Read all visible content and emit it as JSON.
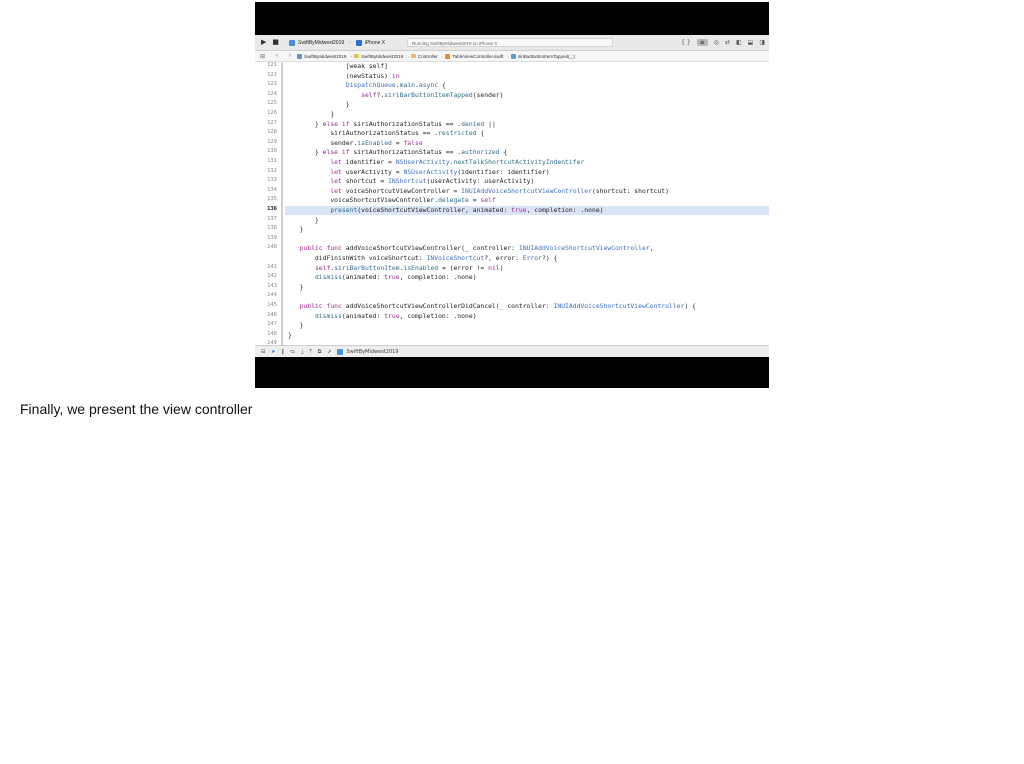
{
  "caption": "Finally, we present the view controller",
  "toolbar": {
    "run_icon": "play-icon",
    "stop_icon": "stop-icon",
    "scheme": "SwiftByMidwest2019",
    "device": "iPhone X",
    "status": "Running SwiftByMidwest2019 on iPhone X",
    "right_icons": [
      "curly-braces-icon",
      "standard-editor-icon",
      "assistant-editor-icon",
      "version-editor-icon",
      "navigator-toggle-icon",
      "debug-area-toggle-icon",
      "inspector-toggle-icon"
    ]
  },
  "jumpbar": {
    "crumbs": [
      "SwiftByMidwest2019",
      "SwiftByMidwest2019",
      "Controller",
      "TableViewController.swift",
      "siriBarButtonItemTapped(_:)"
    ]
  },
  "gutter": [
    "121",
    "122",
    "123",
    "124",
    "125",
    "126",
    "127",
    "128",
    "129",
    "130",
    "131",
    "132",
    "133",
    "134",
    "135",
    "136",
    "137",
    "138",
    "139",
    "140",
    "",
    "141",
    "142",
    "143",
    "144",
    "145",
    "146",
    "147",
    "148",
    "149"
  ],
  "current_line": "136",
  "code_lines": [
    [
      [
        "p",
        "               [weak self]"
      ]
    ],
    [
      [
        "p",
        "               (newStatus) "
      ],
      [
        "k",
        "in"
      ]
    ],
    [
      [
        "p",
        "               "
      ],
      [
        "t",
        "DispatchQueue"
      ],
      [
        "p",
        "."
      ],
      [
        "r",
        "main"
      ],
      [
        "p",
        "."
      ],
      [
        "r",
        "async"
      ],
      [
        "p",
        " {"
      ]
    ],
    [
      [
        "p",
        "                   "
      ],
      [
        "k",
        "self"
      ],
      [
        "p",
        "?."
      ],
      [
        "r",
        "siriBarButtonItemTapped"
      ],
      [
        "p",
        "(sender)"
      ]
    ],
    [
      [
        "p",
        "               }"
      ]
    ],
    [
      [
        "p",
        "           }"
      ]
    ],
    [
      [
        "p",
        "       } "
      ],
      [
        "k",
        "else if"
      ],
      [
        "p",
        " siriAuthorizationStatus == ."
      ],
      [
        "r",
        "denied"
      ],
      [
        "p",
        " ||"
      ]
    ],
    [
      [
        "p",
        "           siriAuthorizationStatus == ."
      ],
      [
        "r",
        "restricted"
      ],
      [
        "p",
        " {"
      ]
    ],
    [
      [
        "p",
        "           sender."
      ],
      [
        "r",
        "isEnabled"
      ],
      [
        "p",
        " = "
      ],
      [
        "k",
        "false"
      ]
    ],
    [
      [
        "p",
        "       } "
      ],
      [
        "k",
        "else if"
      ],
      [
        "p",
        " siriAuthorizationStatus == ."
      ],
      [
        "r",
        "authorized"
      ],
      [
        "p",
        " {"
      ]
    ],
    [
      [
        "p",
        "           "
      ],
      [
        "k",
        "let"
      ],
      [
        "p",
        " identifier = "
      ],
      [
        "t",
        "NSUserActivity"
      ],
      [
        "p",
        "."
      ],
      [
        "r",
        "nextTalkShortcutActivityIndentifer"
      ]
    ],
    [
      [
        "p",
        "           "
      ],
      [
        "k",
        "let"
      ],
      [
        "p",
        " userActivity = "
      ],
      [
        "t",
        "NSUserActivity"
      ],
      [
        "p",
        "(identifier: identifier)"
      ]
    ],
    [
      [
        "p",
        "           "
      ],
      [
        "k",
        "let"
      ],
      [
        "p",
        " shortcut = "
      ],
      [
        "t",
        "INShortcut"
      ],
      [
        "p",
        "(userActivity: userActivity)"
      ]
    ],
    [
      [
        "p",
        "           "
      ],
      [
        "k",
        "let"
      ],
      [
        "p",
        " voiceShortcutViewController = "
      ],
      [
        "t",
        "INUIAddVoiceShortcutViewController"
      ],
      [
        "p",
        "(shortcut: shortcut)"
      ]
    ],
    [
      [
        "p",
        "           voiceShortcutViewController."
      ],
      [
        "r",
        "delegate"
      ],
      [
        "p",
        " = "
      ],
      [
        "k",
        "self"
      ]
    ],
    [
      [
        "p",
        "           "
      ],
      [
        "r",
        "present"
      ],
      [
        "p",
        "(voiceShortcutViewController, animated: "
      ],
      [
        "k",
        "true"
      ],
      [
        "p",
        ", completion: .none)"
      ]
    ],
    [
      [
        "p",
        "       }"
      ]
    ],
    [
      [
        "p",
        "   }"
      ]
    ],
    [
      [
        "p",
        ""
      ]
    ],
    [
      [
        "p",
        "   "
      ],
      [
        "k",
        "public func"
      ],
      [
        "p",
        " addVoiceShortcutViewController(_ controller: "
      ],
      [
        "t",
        "INUIAddVoiceShortcutViewController"
      ],
      [
        "p",
        ","
      ]
    ],
    [
      [
        "p",
        "       didFinishWith voiceShortcut: "
      ],
      [
        "t",
        "INVoiceShortcut"
      ],
      [
        "p",
        "?, error: "
      ],
      [
        "t",
        "Error"
      ],
      [
        "p",
        "?) {"
      ]
    ],
    [
      [
        "p",
        "       "
      ],
      [
        "k",
        "self"
      ],
      [
        "p",
        "."
      ],
      [
        "r",
        "siriBarButtonItem"
      ],
      [
        "p",
        "."
      ],
      [
        "r",
        "isEnabled"
      ],
      [
        "p",
        " = (error != "
      ],
      [
        "k",
        "nil"
      ],
      [
        "p",
        ")"
      ]
    ],
    [
      [
        "p",
        "       "
      ],
      [
        "r",
        "dismiss"
      ],
      [
        "p",
        "(animated: "
      ],
      [
        "k",
        "true"
      ],
      [
        "p",
        ", completion: .none)"
      ]
    ],
    [
      [
        "p",
        "   }"
      ]
    ],
    [
      [
        "p",
        ""
      ]
    ],
    [
      [
        "p",
        "   "
      ],
      [
        "k",
        "public func"
      ],
      [
        "p",
        " addVoiceShortcutViewControllerDidCancel(_ controller: "
      ],
      [
        "t",
        "INUIAddVoiceShortcutViewController"
      ],
      [
        "p",
        ") {"
      ]
    ],
    [
      [
        "p",
        "       "
      ],
      [
        "r",
        "dismiss"
      ],
      [
        "p",
        "(animated: "
      ],
      [
        "k",
        "true"
      ],
      [
        "p",
        ", completion: .none)"
      ]
    ],
    [
      [
        "p",
        "   }"
      ]
    ],
    [
      [
        "p",
        "}"
      ]
    ],
    [
      [
        "p",
        ""
      ]
    ]
  ],
  "bottom_bar": {
    "target": "SwiftByMidwest2019",
    "icons": [
      "hide-debug-icon",
      "breakpoints-icon",
      "pause-icon",
      "step-over-icon",
      "step-in-icon",
      "step-out-icon",
      "debug-view-icon",
      "simulate-location-icon"
    ]
  },
  "colors": {
    "keyword": "#a0288d",
    "type": "#3d6fb8",
    "property": "#2f6d8b",
    "highlight": "#d9e5f7"
  }
}
